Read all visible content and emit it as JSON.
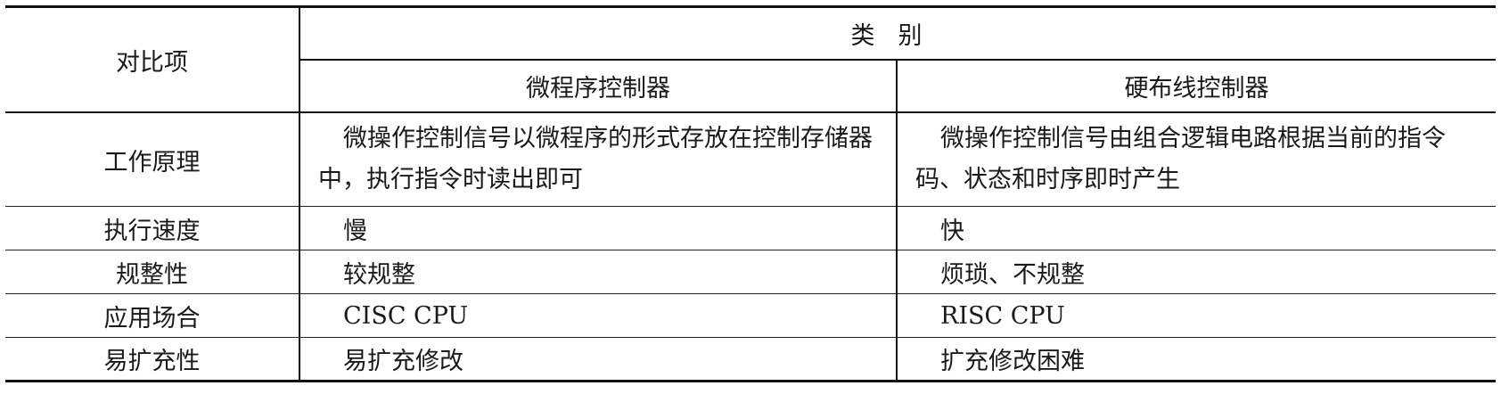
{
  "table": {
    "header": {
      "item": "对比项",
      "category": "类别",
      "col1": "微程序控制器",
      "col2": "硬布线控制器"
    },
    "rows": [
      {
        "label": "工作原理",
        "micro": "微操作控制信号以微程序的形式存放在控制存储器中，执行指令时读出即可",
        "hard": "微操作控制信号由组合逻辑电路根据当前的指令码、状态和时序即时产生"
      },
      {
        "label": "执行速度",
        "micro": "慢",
        "hard": "快"
      },
      {
        "label": "规整性",
        "micro": "较规整",
        "hard": "烦琐、不规整"
      },
      {
        "label": "应用场合",
        "micro": "CISC CPU",
        "hard": "RISC CPU"
      },
      {
        "label": "易扩充性",
        "micro": "易扩充修改",
        "hard": "扩充修改困难"
      }
    ]
  }
}
